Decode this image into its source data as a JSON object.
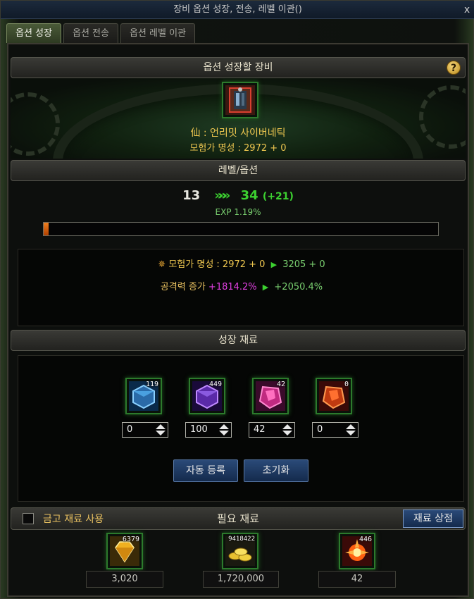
{
  "window": {
    "title": "장비 옵션 성장, 전송, 레벨 이관()",
    "close_label": "x"
  },
  "tabs": [
    {
      "label": "옵션 성장",
      "active": true
    },
    {
      "label": "옵션 전송",
      "active": false
    },
    {
      "label": "옵션 레벨 이관",
      "active": false
    }
  ],
  "equipment": {
    "header": "옵션 성장할 장비",
    "help_label": "?",
    "name": "仙 : 언리밋 사이버네틱",
    "fame": "모험가 명성 : 2972 + 0",
    "icon": "cybernetic-armor-icon"
  },
  "level": {
    "header": "레벨/옵션",
    "from": "13",
    "arrow": "»»»",
    "to": "34",
    "plus": "(+21)",
    "exp_label": "EXP 1.19%",
    "exp_fraction": 0.0119
  },
  "stats": {
    "fame_prefix": "모험가 명성 : 2972 + 0",
    "fame_after": "3205 + 0",
    "attack_label": "공격력 증가",
    "attack_before": "+1814.2%",
    "attack_after": "+2050.4%",
    "arrow": "▶"
  },
  "materials": {
    "header": "성장 재료",
    "items": [
      {
        "icon": "blue-crystal-icon",
        "count": "119",
        "value": "0"
      },
      {
        "icon": "purple-crystal-icon",
        "count": "449",
        "value": "100"
      },
      {
        "icon": "pink-crystal-icon",
        "count": "42",
        "value": "42"
      },
      {
        "icon": "red-crystal-icon",
        "count": "0",
        "value": "0"
      }
    ],
    "auto_register_label": "자동 등록",
    "reset_label": "초기화"
  },
  "required": {
    "title": "필요 재료",
    "use_vault_label": "금고 재료 사용",
    "shop_label": "재료 상점",
    "items": [
      {
        "icon": "gold-gem-icon",
        "count": "6379",
        "amount": "3,020"
      },
      {
        "icon": "gold-coins-icon",
        "count": "9418422",
        "amount": "1,720,000"
      },
      {
        "icon": "burst-orb-icon",
        "count": "446",
        "amount": "42"
      }
    ]
  },
  "colors": {
    "accent_green": "#3cd030",
    "gold_text": "#f0c850",
    "magenta": "#e040e0",
    "button_blue": "#1e3a64"
  }
}
